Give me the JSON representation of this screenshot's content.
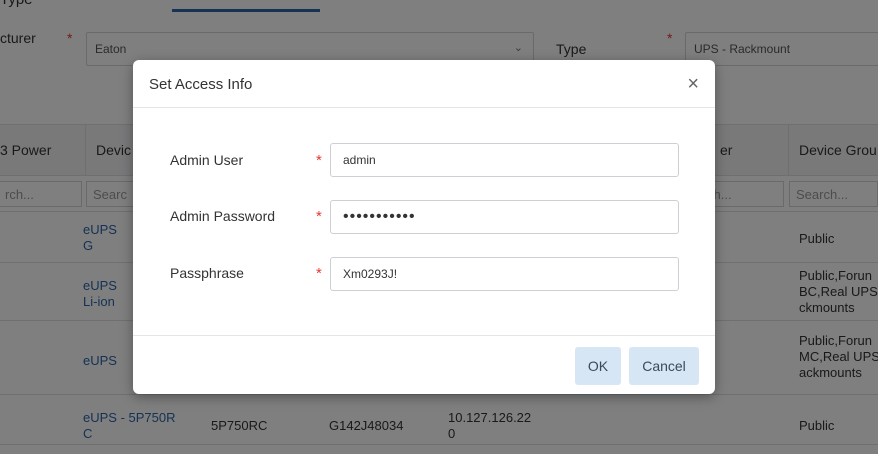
{
  "page": {
    "top_label": "Type"
  },
  "filters": {
    "manufacturer_label": "cturer",
    "manufacturer_value": "Eaton",
    "type_label": "Type",
    "type_value": "UPS - Rackmount"
  },
  "table": {
    "columns": [
      "3 Power",
      "Devic",
      "er",
      "Device Grou"
    ],
    "search_placeholder": "Search...",
    "search_cells": [
      "rch...",
      "Searc",
      "ch...",
      "Search..."
    ],
    "rows": [
      {
        "device": "eUPS\nG",
        "group": "Public"
      },
      {
        "device": "eUPS\nLi-ion",
        "group": "Public,Forun\nBC,Real UPS\nckmounts"
      },
      {
        "device": "eUPS",
        "group": "Public,Forun\nMC,Real UPS\nackmounts"
      },
      {
        "device": "eUPS - 5P750R\nC",
        "model": "5P750RC",
        "serial": "G142J48034",
        "ip": "10.127.126.22\n0",
        "group": "Public"
      }
    ]
  },
  "modal": {
    "title": "Set Access Info",
    "close_glyph": "×",
    "fields": {
      "admin_user_label": "Admin User",
      "admin_user_value": "admin",
      "admin_password_label": "Admin Password",
      "admin_password_value": "Xm0293J!pw1",
      "passphrase_label": "Passphrase",
      "passphrase_value": "Xm0293J!"
    },
    "required_mark": "*",
    "ok_label": "OK",
    "cancel_label": "Cancel"
  },
  "icons": {
    "close": "close-icon",
    "caret": "chevron-down-icon"
  },
  "colors": {
    "accent": "#2c64a8",
    "required": "#e53935",
    "button_bg": "#d7e6f4",
    "overlay": "rgba(0,0,0,0.5)"
  }
}
